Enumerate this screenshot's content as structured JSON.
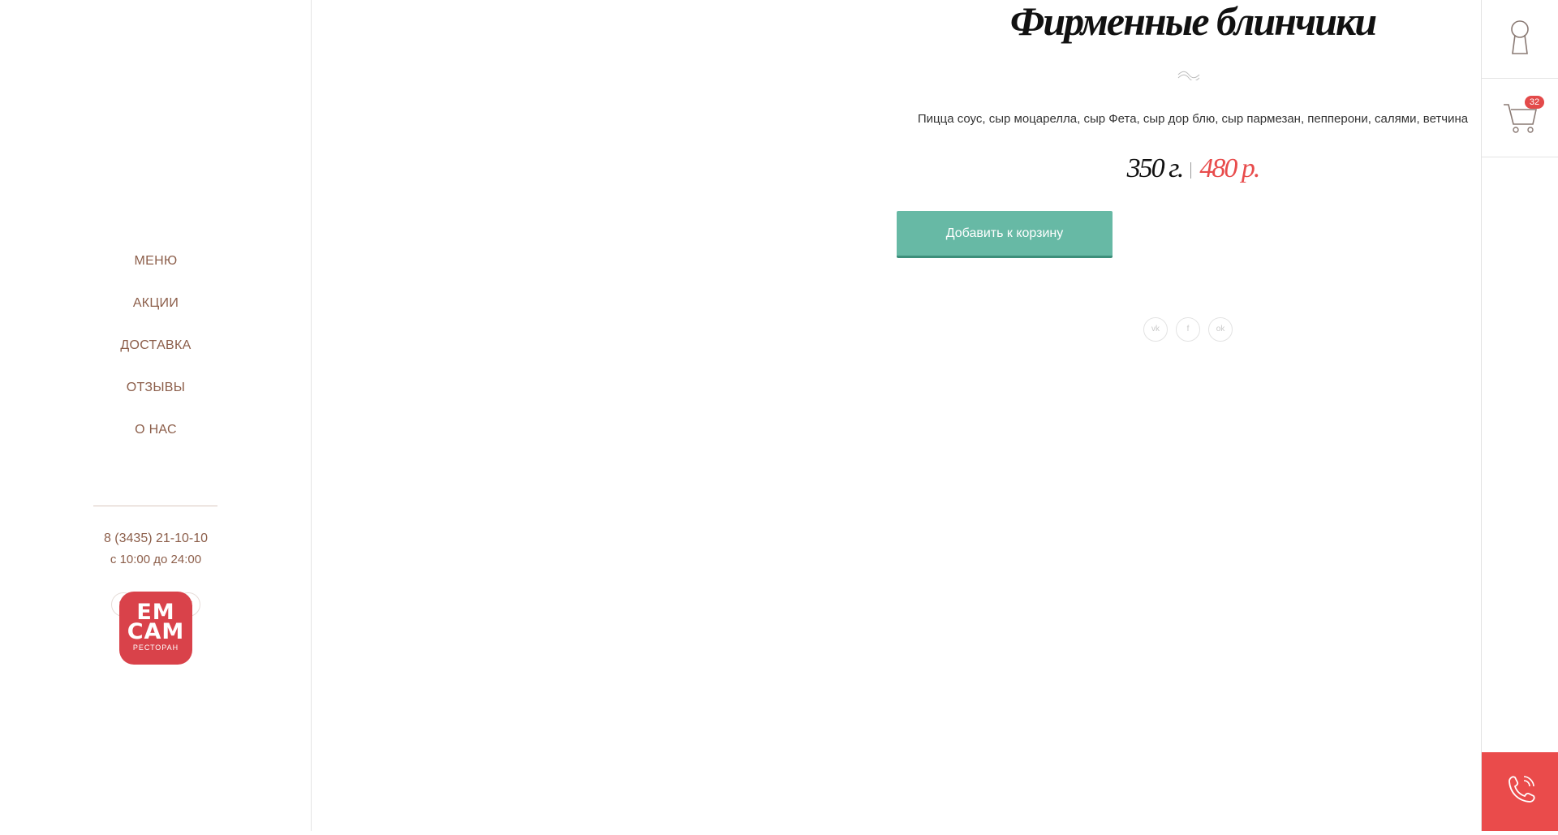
{
  "sidebar": {
    "nav": [
      {
        "label": "МЕНЮ"
      },
      {
        "label": "АКЦИИ"
      },
      {
        "label": "ДОСТАВКА"
      },
      {
        "label": "ОТЗЫВЫ"
      },
      {
        "label": "О НАС"
      }
    ],
    "phone": "8 (3435) 21-10-10",
    "hours": "с 10:00 до 24:00",
    "social": {
      "vk": "vk",
      "ok": "ok"
    },
    "logo": {
      "line1": "ЕМ",
      "line2": "САМ",
      "line3": "РЕСТОРАН",
      "color": "#d9424a"
    }
  },
  "product": {
    "title": "Фирменные блинчики",
    "description": "Пицца соус, сыр моцарелла, сыр Фета, сыр дор блю, сыр пармезан, пепперони, салями, ветчина",
    "weight": "350 г.",
    "price": "480 р.",
    "add_to_cart_label": "Добавить к корзину",
    "share_icons": [
      "vk",
      "f",
      "ok"
    ]
  },
  "rail": {
    "cart_count": "32",
    "login_icon": "keyhole-icon",
    "cart_icon": "cart-icon",
    "call_icon": "phone-icon",
    "call_bg": "#ea4b4b"
  },
  "colors": {
    "accent": "#67b9a5",
    "price": "#e84c4c",
    "nav_text": "#8c5e4a"
  }
}
